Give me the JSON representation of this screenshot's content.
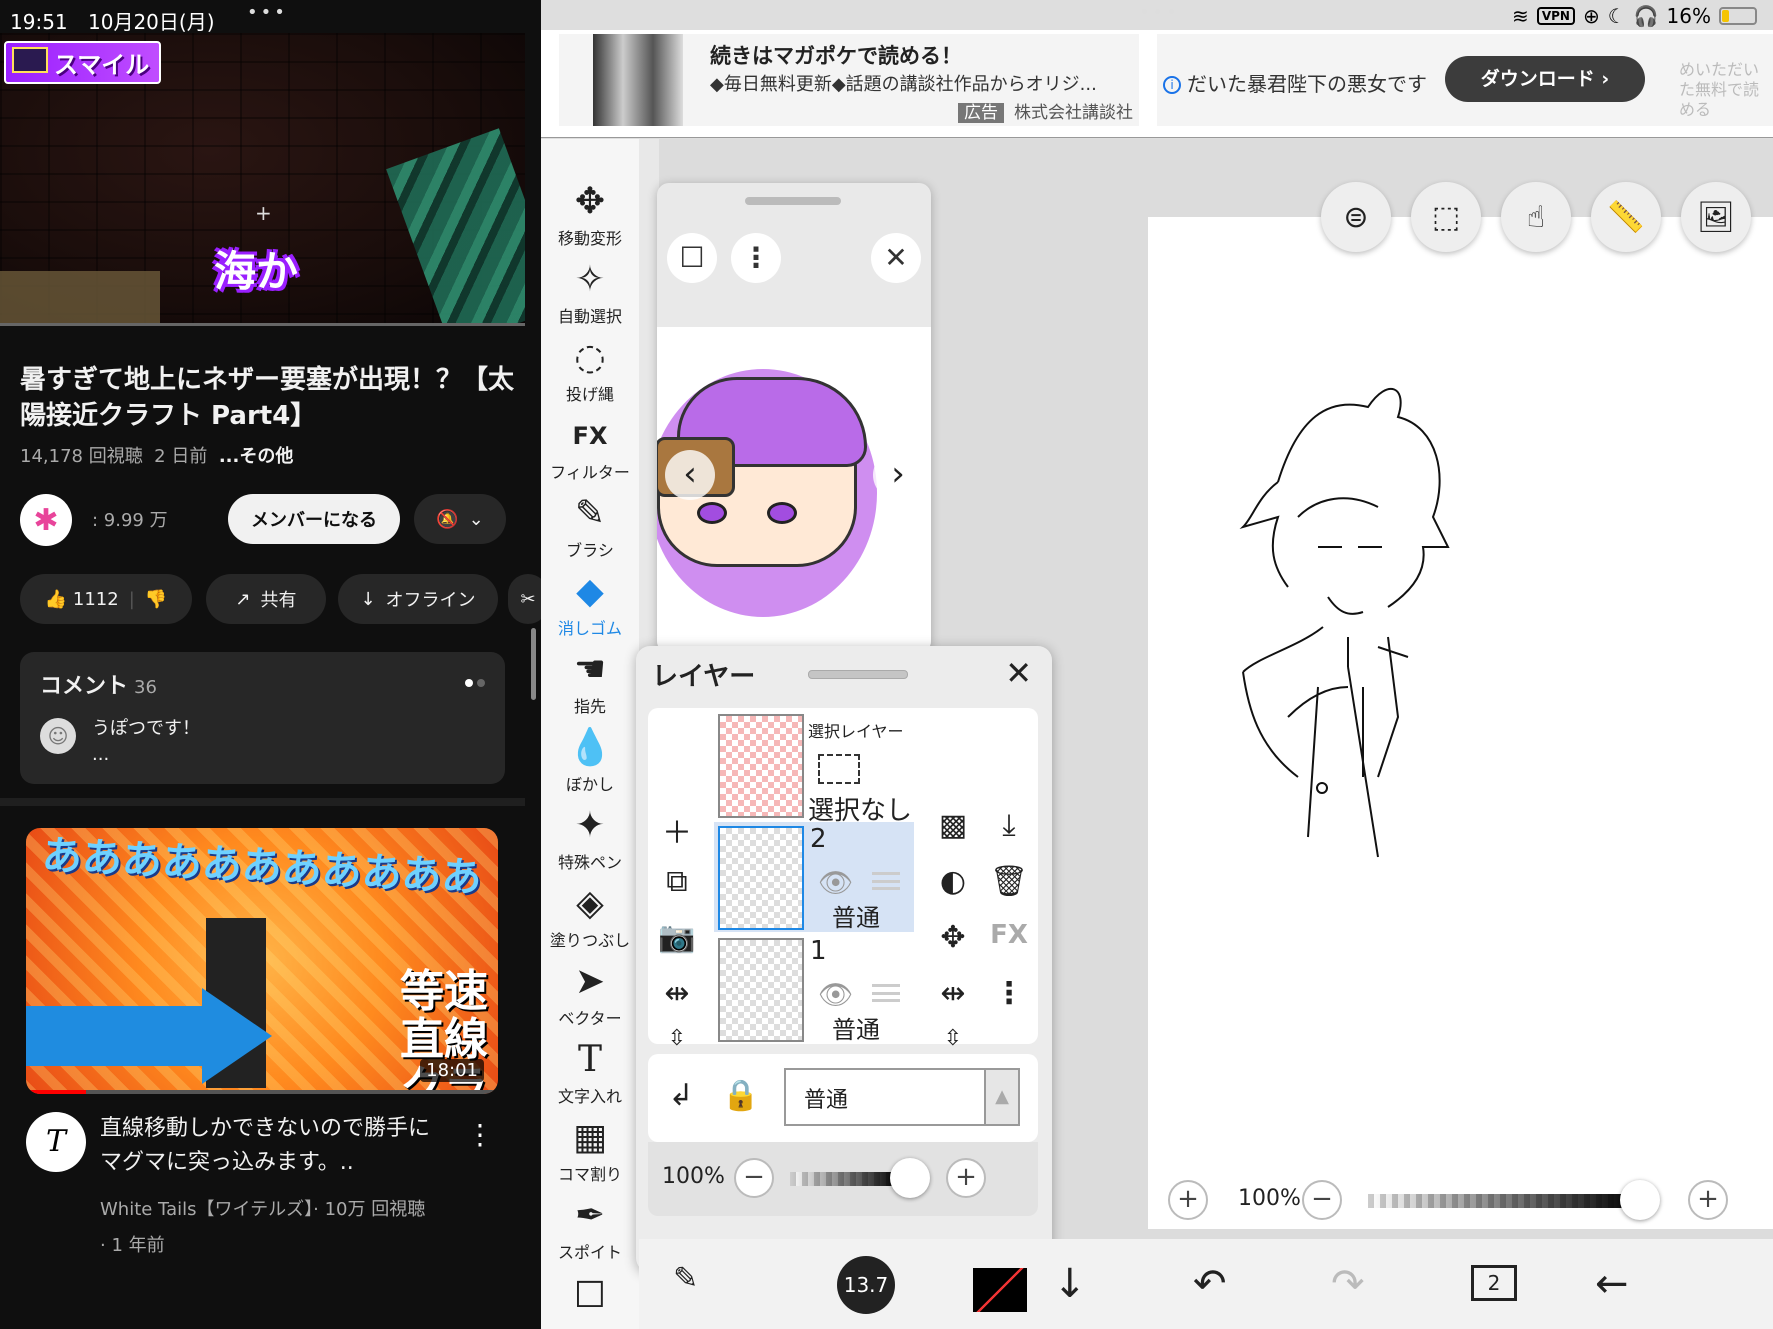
{
  "left": {
    "status": {
      "time": "19:51",
      "date": "10月20日(月)"
    },
    "player": {
      "channel_badge": "スマイル",
      "caption": "海か",
      "crosshair": "+"
    },
    "video": {
      "title": "暑すぎて地上にネザー要塞が出現！？【太陽接近クラフト Part4】",
      "views": "14,178 回視聴",
      "age": "2 日前",
      "more": "...その他"
    },
    "channel": {
      "subscribers": "9.99 万",
      "member_button": "メンバーになる"
    },
    "actions": {
      "likes": "1112",
      "share": "共有",
      "offline": "オフライン"
    },
    "comments": {
      "label": "コメント",
      "count": "36",
      "top_comment": "うぽつです！",
      "ellipsis": "..."
    },
    "next_video": {
      "thumb_text": "あああああああああああ",
      "thumb_big": "等速直線クラフト",
      "duration": "18:01",
      "title": "直線移動しかできないので勝手にマグマに突っ込みます。..",
      "channel_meta": "White Tails【ワイテルズ】· 10万 回視聴",
      "age": "· 1 年前",
      "avatar_letter": "T"
    }
  },
  "right": {
    "status": {
      "vpn": "VPN",
      "battery": "16%"
    },
    "ad1": {
      "title": "続きはマガポケで読める！",
      "desc": "◆毎日無料更新◆話題の講談社作品からオリジ...",
      "tag": "広告",
      "sponsor": "株式会社講談社"
    },
    "ad2": {
      "text": "だいた暴君陛下の悪女です",
      "button": "ダウンロード  ›",
      "fade": "めいただいた無料で読める"
    },
    "tools": [
      {
        "icon": "✥",
        "label": "移動変形"
      },
      {
        "icon": "✧",
        "label": "自動選択"
      },
      {
        "icon": "◌",
        "label": "投げ縄"
      },
      {
        "icon": "FX",
        "label": "フィルター"
      },
      {
        "icon": "✎",
        "label": "ブラシ"
      },
      {
        "icon": "◆",
        "label": "消しゴム"
      },
      {
        "icon": "☚",
        "label": "指先"
      },
      {
        "icon": "💧",
        "label": "ぼかし"
      },
      {
        "icon": "✦",
        "label": "特殊ペン"
      },
      {
        "icon": "◈",
        "label": "塗りつぶし"
      },
      {
        "icon": "➤",
        "label": "ベクター"
      },
      {
        "icon": "T",
        "label": "文字入れ"
      },
      {
        "icon": "▦",
        "label": "コマ割り"
      },
      {
        "icon": "✒",
        "label": "スポイト"
      }
    ],
    "active_tool": "消しゴム",
    "layers": {
      "title": "レイヤー",
      "selection_layer": {
        "name": "選択レイヤー",
        "status": "選択なし"
      },
      "items": [
        {
          "num": "2",
          "mode": "普通"
        },
        {
          "num": "1",
          "mode": "普通"
        }
      ],
      "blend_mode": "普通",
      "opacity": "100%"
    },
    "canvas": {
      "zoom": "100%"
    },
    "bottom": {
      "brush_size": "13.7",
      "layer_count": "2"
    }
  }
}
